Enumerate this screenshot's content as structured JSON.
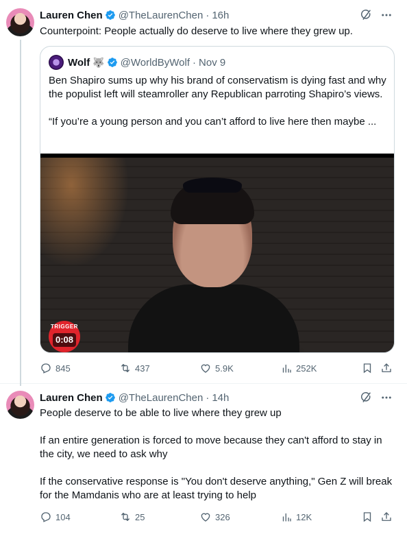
{
  "tweets": [
    {
      "author_name": "Lauren Chen",
      "handle": "@TheLaurenChen",
      "separator": "·",
      "time": "16h",
      "text": "Counterpoint: People actually do deserve to live where they grew up.",
      "quote": {
        "author_name": "Wolf",
        "author_emoji": "🐺",
        "handle": "@WorldByWolf",
        "separator": "·",
        "date": "Nov 9",
        "paragraphs": [
          "Ben Shapiro sums up why his brand of conservatism is dying fast and why the populist left will steamroller any Republican parroting Shapiro’s views.",
          "“If you’re a young person and you can’t afford to live here then maybe ..."
        ],
        "video": {
          "badge_label": "TRIGGER",
          "duration": "0:08"
        }
      },
      "stats": {
        "replies": "845",
        "reposts": "437",
        "likes": "5.9K",
        "views": "252K"
      }
    },
    {
      "author_name": "Lauren Chen",
      "handle": "@TheLaurenChen",
      "separator": "·",
      "time": "14h",
      "paragraphs": [
        "People deserve to be able to live where they grew up",
        "If an entire generation is forced to move because they can't afford to stay in the city, we need to ask why",
        "If the conservative response is \"You don't deserve anything,\" Gen Z will break for the Mamdanis who are at least trying to help"
      ],
      "stats": {
        "replies": "104",
        "reposts": "25",
        "likes": "326",
        "views": "12K"
      }
    }
  ],
  "colors": {
    "verified_blue": "#1d9bf0",
    "secondary_text": "#536471",
    "border": "#cfd9de",
    "trigger_red": "#e0242c"
  },
  "icons": [
    "verified-icon",
    "grok-icon",
    "more-icon",
    "reply-icon",
    "retweet-icon",
    "like-icon",
    "views-icon",
    "bookmark-icon",
    "share-icon"
  ]
}
